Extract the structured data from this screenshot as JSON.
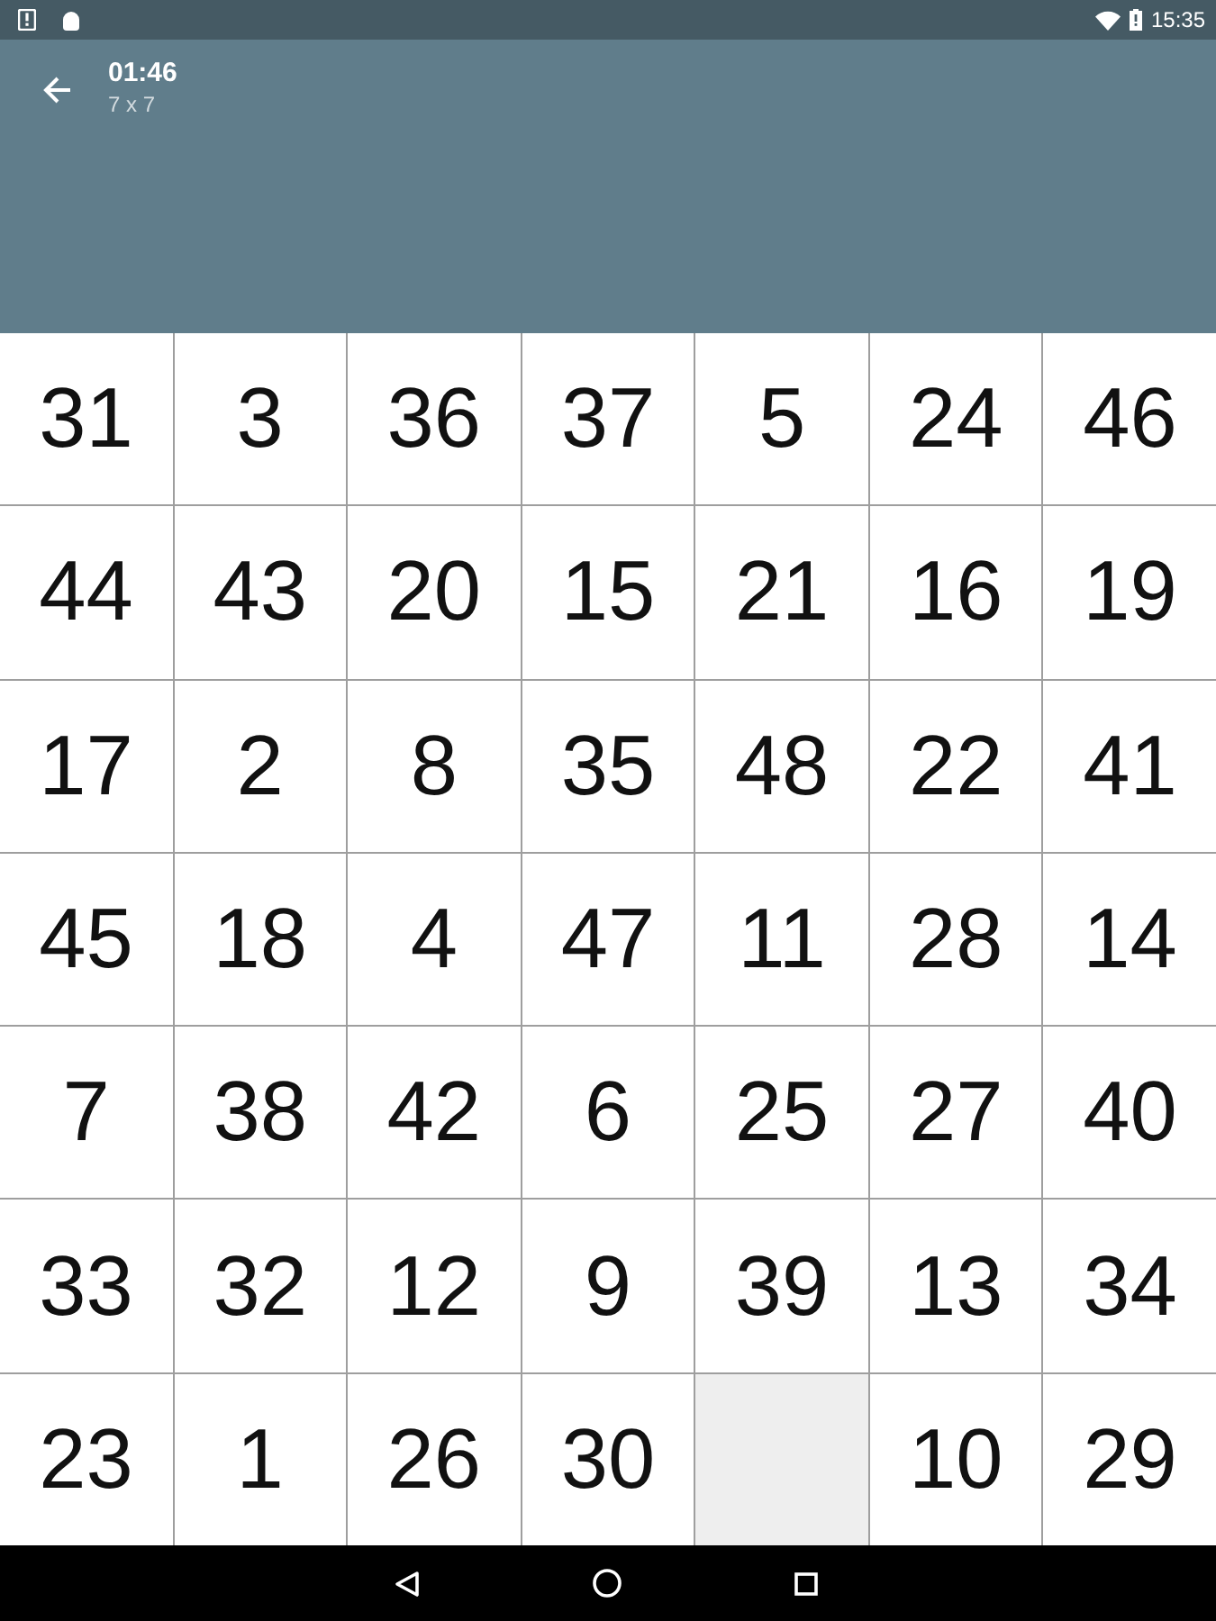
{
  "status_bar": {
    "time": "15:35"
  },
  "app_bar": {
    "title": "01:46",
    "subtitle": "7 x 7"
  },
  "board": {
    "rows": [
      [
        {
          "kind": "number",
          "label": "31"
        },
        {
          "kind": "number",
          "label": "3"
        },
        {
          "kind": "number",
          "label": "36"
        },
        {
          "kind": "number",
          "label": "37"
        },
        {
          "kind": "number",
          "label": "5"
        },
        {
          "kind": "number",
          "label": "24"
        },
        {
          "kind": "number",
          "label": "46"
        }
      ],
      [
        {
          "kind": "number",
          "label": "44"
        },
        {
          "kind": "number",
          "label": "43"
        },
        {
          "kind": "number",
          "label": "20"
        },
        {
          "kind": "number",
          "label": "15"
        },
        {
          "kind": "number",
          "label": "21"
        },
        {
          "kind": "number",
          "label": "16"
        },
        {
          "kind": "number",
          "label": "19"
        }
      ],
      [
        {
          "kind": "number",
          "label": "17"
        },
        {
          "kind": "number",
          "label": "2"
        },
        {
          "kind": "number",
          "label": "8"
        },
        {
          "kind": "number",
          "label": "35"
        },
        {
          "kind": "number",
          "label": "48"
        },
        {
          "kind": "number",
          "label": "22"
        },
        {
          "kind": "number",
          "label": "41"
        }
      ],
      [
        {
          "kind": "number",
          "label": "45"
        },
        {
          "kind": "number",
          "label": "18"
        },
        {
          "kind": "number",
          "label": "4"
        },
        {
          "kind": "number",
          "label": "47"
        },
        {
          "kind": "number",
          "label": "11"
        },
        {
          "kind": "number",
          "label": "28"
        },
        {
          "kind": "number",
          "label": "14"
        }
      ],
      [
        {
          "kind": "number",
          "label": "7"
        },
        {
          "kind": "number",
          "label": "38"
        },
        {
          "kind": "number",
          "label": "42"
        },
        {
          "kind": "number",
          "label": "6"
        },
        {
          "kind": "number",
          "label": "25"
        },
        {
          "kind": "number",
          "label": "27"
        },
        {
          "kind": "number",
          "label": "40"
        }
      ],
      [
        {
          "kind": "number",
          "label": "33"
        },
        {
          "kind": "number",
          "label": "32"
        },
        {
          "kind": "number",
          "label": "12"
        },
        {
          "kind": "number",
          "label": "9"
        },
        {
          "kind": "number",
          "label": "39"
        },
        {
          "kind": "number",
          "label": "13"
        },
        {
          "kind": "number",
          "label": "34"
        }
      ],
      [
        {
          "kind": "number",
          "label": "23"
        },
        {
          "kind": "number",
          "label": "1"
        },
        {
          "kind": "number",
          "label": "26"
        },
        {
          "kind": "number",
          "label": "30"
        },
        {
          "kind": "empty"
        },
        {
          "kind": "number",
          "label": "10"
        },
        {
          "kind": "number",
          "label": "29"
        }
      ]
    ]
  }
}
